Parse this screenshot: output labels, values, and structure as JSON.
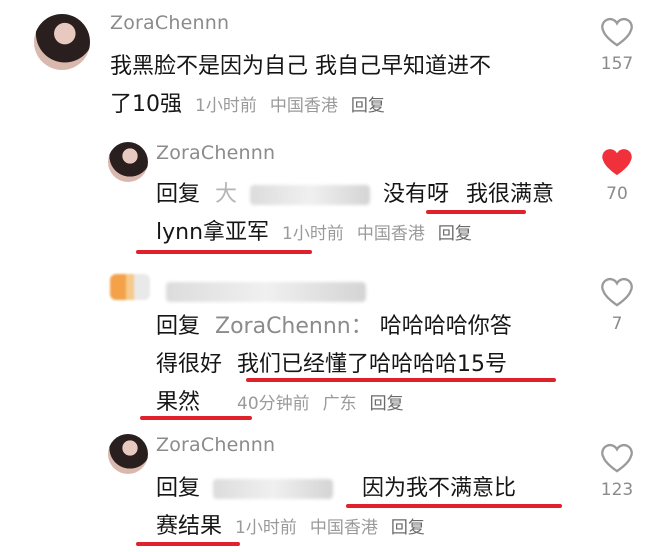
{
  "comments": [
    {
      "username": "ZoraChennn",
      "text_line1": "我黑脸不是因为自己 我自己早知道进不",
      "text_line2": "了10强",
      "time": "1小时前",
      "location": "中国香港",
      "reply_label": "回复",
      "likes": "157",
      "liked": false
    },
    {
      "username": "ZoraChennn",
      "reply_prefix": "回复",
      "reply_to_partial": "大",
      "text_part1": "没有呀",
      "text_part2": "我很满意",
      "text_line2": "lynn拿亚军",
      "time": "1小时前",
      "location": "中国香港",
      "reply_label": "回复",
      "likes": "70",
      "liked": true
    },
    {
      "reply_prefix": "回复",
      "reply_to": "ZoraChennn：",
      "text_part1": "哈哈哈哈你答",
      "text_line2_part1": "得很好",
      "text_line2_part2": "我们已经懂了哈哈哈哈15号",
      "text_line3": "果然",
      "time": "40分钟前",
      "location": "广东",
      "reply_label": "回复",
      "likes": "7",
      "liked": false
    },
    {
      "username": "ZoraChennn",
      "reply_prefix": "回复",
      "text_part1": "因为我不满意比",
      "text_line2": "赛结果",
      "time": "1小时前",
      "location": "中国香港",
      "reply_label": "回复",
      "likes": "123",
      "liked": false
    }
  ],
  "colors": {
    "accent_red": "#e0202a",
    "like_red": "#f0303a"
  }
}
